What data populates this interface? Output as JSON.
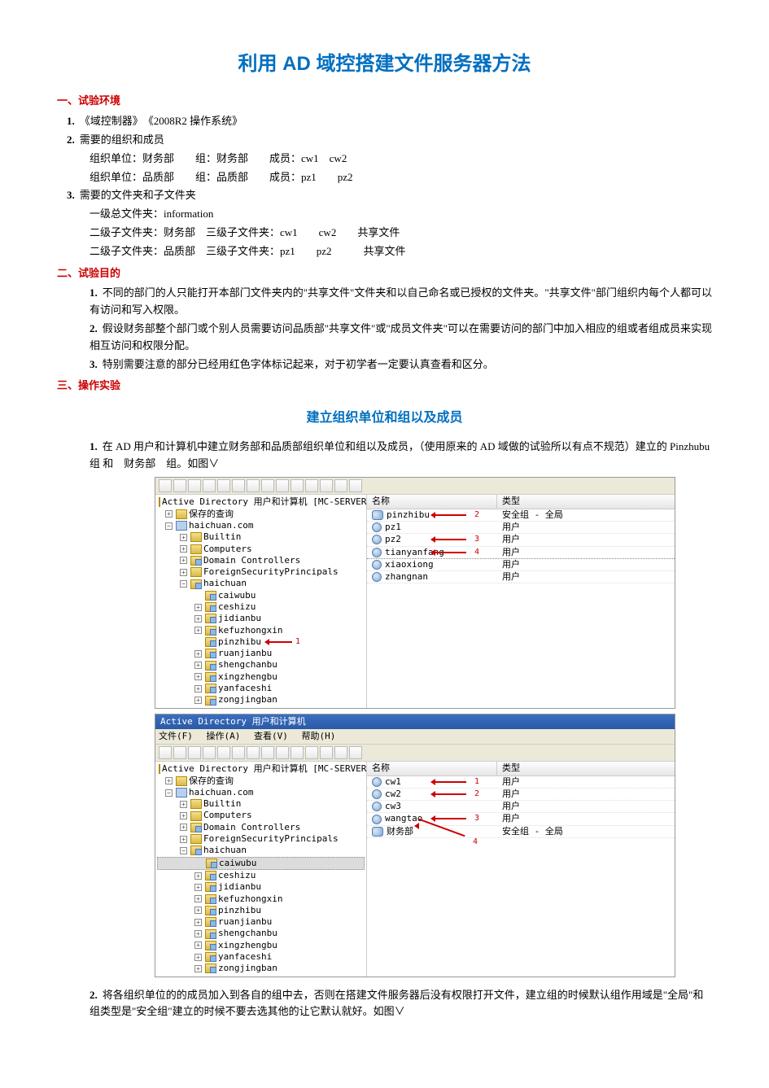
{
  "title": "利用 AD 域控搭建文件服务器方法",
  "sections": {
    "s1": {
      "title": "一、试验环境"
    },
    "s2": {
      "title": "二、试验目的"
    },
    "s3": {
      "title": "三、操作实验"
    }
  },
  "env": {
    "i1_num": "1.",
    "i1": "《域控制器》　《2008R2 操作系统》",
    "i2_num": "2.",
    "i2": "需要的组织和成员",
    "i2a": "组织单位：财务部　　组：财务部　　成员：cw1　cw2",
    "i2b": "组织单位：品质部　　组：品质部　　成员：pz1　　pz2",
    "i3_num": "3.",
    "i3": "需要的文件夹和子文件夹",
    "i3a": "一级总文件夹：information",
    "i3b": "二级子文件夹：财务部　三级子文件夹：cw1　　cw2　　共享文件",
    "i3c": "二级子文件夹：品质部　三级子文件夹：pz1　　pz2　　　共享文件"
  },
  "goal": {
    "i1_num": "1.",
    "i1": "不同的部门的人只能打开本部门文件夹内的\"共享文件\"文件夹和以自己命名或已授权的文件夹。\"共享文件\"部门组织内每个人都可以有访问和写入权限。",
    "i2_num": "2.",
    "i2": "假设财务部整个部门或个别人员需要访问品质部\"共享文件\"或\"成员文件夹\"可以在需要访问的部门中加入相应的组或者组成员来实现相互访问和权限分配。",
    "i3_num": "3.",
    "i3": "特别需要注意的部分已经用红色字体标记起来，对于初学者一定要认真查看和区分。"
  },
  "subTitle": "建立组织单位和组以及成员",
  "exp": {
    "i1_num": "1.",
    "i1": "在 AD 用户和计算机中建立财务部和品质部组织单位和组以及成员，（使用原来的 AD 域做的试验所以有点不规范）建立的 Pinzhubu 组 和　财务部　组。如图∨",
    "i2_num": "2.",
    "i2": "将各组织单位的的成员加入到各自的组中去，否则在搭建文件服务器后没有权限打开文件，建立组的时候默认组作用域是\"全局\"和组类型是\"安全组\"建立的时候不要去选其他的让它默认就好。如图∨"
  },
  "win_common": {
    "root": "Active Directory 用户和计算机 [MC-SERVER.hai",
    "saved_query": "保存的查询",
    "domain": "haichuan.com",
    "builtin": "Builtin",
    "computers": "Computers",
    "dc": "Domain Controllers",
    "fsp": "ForeignSecurityPrincipals",
    "haichuan": "haichuan",
    "caiwubu": "caiwubu",
    "ceshizu": "ceshizu",
    "jidianbu": "jidianbu",
    "kefu": "kefuzhongxin",
    "pinzhibu": "pinzhibu",
    "ruanjianbu": "ruanjianbu",
    "shengchanbu": "shengchanbu",
    "xingzhengbu": "xingzhengbu",
    "yanfaceshi": "yanfaceshi",
    "zongjingban": "zongjingban",
    "col_name": "名称",
    "col_type": "类型",
    "type_grp": "安全组 - 全局",
    "type_user": "用户"
  },
  "win1": {
    "list": [
      {
        "ico": "grp",
        "name": "pinzhibu",
        "type": "安全组 - 全局",
        "annot": "2"
      },
      {
        "ico": "user",
        "name": "pz1",
        "type": "用户",
        "annot": ""
      },
      {
        "ico": "user",
        "name": "pz2",
        "type": "用户",
        "annot": "3"
      },
      {
        "ico": "user",
        "name": "tianyanfang",
        "type": "用户",
        "annot": "4",
        "dash": true
      },
      {
        "ico": "user",
        "name": "xiaoxiong",
        "type": "用户",
        "annot": ""
      },
      {
        "ico": "user",
        "name": "zhangnan",
        "type": "用户",
        "annot": ""
      }
    ],
    "tree_annot": "1"
  },
  "win2": {
    "title": "Active Directory 用户和计算机",
    "menu": {
      "file": "文件(F)",
      "action": "操作(A)",
      "view": "查看(V)",
      "help": "帮助(H)"
    },
    "list": [
      {
        "ico": "user",
        "name": "cw1",
        "type": "用户",
        "annot": "1"
      },
      {
        "ico": "user",
        "name": "cw2",
        "type": "用户",
        "annot": "2"
      },
      {
        "ico": "user",
        "name": "cw3",
        "type": "用户",
        "annot": ""
      },
      {
        "ico": "user",
        "name": "wangtao",
        "type": "用户",
        "annot": "3"
      },
      {
        "ico": "grp",
        "name": "财务部",
        "type": "安全组 - 全局",
        "annot": ""
      }
    ],
    "bottom_annot": "4"
  }
}
